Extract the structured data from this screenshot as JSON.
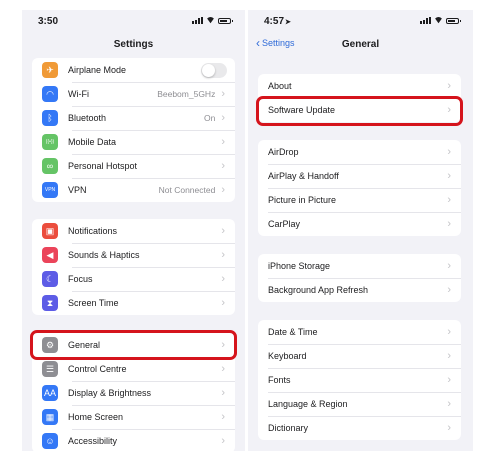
{
  "left": {
    "status": {
      "time": "3:50"
    },
    "title": "Settings",
    "groups": [
      [
        {
          "label": "Airplane Mode",
          "icon": "airplane-icon",
          "color": "#f09a37",
          "glyph": "✈",
          "value": "",
          "control": "toggle"
        },
        {
          "label": "Wi-Fi",
          "icon": "wifi-icon",
          "color": "#3478f6",
          "glyph": "◠",
          "value": "Beebom_5GHz",
          "control": "chevron"
        },
        {
          "label": "Bluetooth",
          "icon": "bluetooth-icon",
          "color": "#3478f6",
          "glyph": "ᛒ",
          "value": "On",
          "control": "chevron"
        },
        {
          "label": "Mobile Data",
          "icon": "antenna-icon",
          "color": "#65c466",
          "glyph": "((•))",
          "value": "",
          "control": "chevron"
        },
        {
          "label": "Personal Hotspot",
          "icon": "hotspot-icon",
          "color": "#65c466",
          "glyph": "∞",
          "value": "",
          "control": "chevron"
        },
        {
          "label": "VPN",
          "icon": "vpn-icon",
          "color": "#3478f6",
          "glyph": "VPN",
          "value": "Not Connected",
          "control": "chevron"
        }
      ],
      [
        {
          "label": "Notifications",
          "icon": "bell-icon",
          "color": "#eb4d3d",
          "glyph": "▣",
          "value": "",
          "control": "chevron"
        },
        {
          "label": "Sounds & Haptics",
          "icon": "speaker-icon",
          "color": "#eb445a",
          "glyph": "◀",
          "value": "",
          "control": "chevron"
        },
        {
          "label": "Focus",
          "icon": "moon-icon",
          "color": "#5d5ce6",
          "glyph": "☾",
          "value": "",
          "control": "chevron"
        },
        {
          "label": "Screen Time",
          "icon": "hourglass-icon",
          "color": "#5d5ce6",
          "glyph": "⧗",
          "value": "",
          "control": "chevron"
        }
      ],
      [
        {
          "label": "General",
          "icon": "gear-icon",
          "color": "#8e8e93",
          "glyph": "⚙",
          "value": "",
          "control": "chevron"
        },
        {
          "label": "Control Centre",
          "icon": "switches-icon",
          "color": "#8e8e93",
          "glyph": "☰",
          "value": "",
          "control": "chevron"
        },
        {
          "label": "Display & Brightness",
          "icon": "aa-icon",
          "color": "#3478f6",
          "glyph": "AA",
          "value": "",
          "control": "chevron"
        },
        {
          "label": "Home Screen",
          "icon": "grid-icon",
          "color": "#3478f6",
          "glyph": "▦",
          "value": "",
          "control": "chevron"
        },
        {
          "label": "Accessibility",
          "icon": "accessibility-icon",
          "color": "#3478f6",
          "glyph": "☺",
          "value": "",
          "control": "chevron"
        }
      ]
    ]
  },
  "right": {
    "status": {
      "time": "4:57"
    },
    "back": "Settings",
    "title": "General",
    "groups": [
      [
        "About",
        "Software Update"
      ],
      [
        "AirDrop",
        "AirPlay & Handoff",
        "Picture in Picture",
        "CarPlay"
      ],
      [
        "iPhone Storage",
        "Background App Refresh"
      ],
      [
        "Date & Time",
        "Keyboard",
        "Fonts",
        "Language & Region",
        "Dictionary"
      ]
    ]
  },
  "highlight_color": "#d5141c"
}
